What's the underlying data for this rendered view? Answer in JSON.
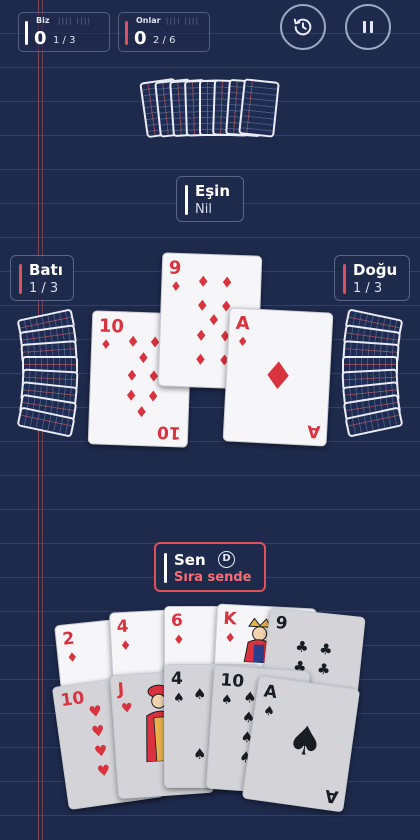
{
  "scores": {
    "us": {
      "label": "Biz",
      "points": "0",
      "tricks": "1 / 3",
      "color": "#ffffff"
    },
    "them": {
      "label": "Onlar",
      "points": "0",
      "tricks": "2 / 6",
      "color": "#e0505a"
    }
  },
  "controls": {
    "history_icon": "history-icon",
    "pause_icon": "pause-icon"
  },
  "players": {
    "partner": {
      "name": "Eşin",
      "bid": "Nil",
      "color": "#ffffff"
    },
    "west": {
      "name": "Batı",
      "tricks": "1 / 3",
      "color": "#e0505a"
    },
    "east": {
      "name": "Doğu",
      "tricks": "1 / 3",
      "color": "#e0505a"
    },
    "me": {
      "name": "Sen",
      "dealer_badge": "D",
      "status": "Sıra sende",
      "color": "#ffffff",
      "status_color": "#ff6b73"
    }
  },
  "table_cards": [
    {
      "rank": "10",
      "suit": "♦",
      "color": "red"
    },
    {
      "rank": "9",
      "suit": "♦",
      "color": "red"
    },
    {
      "rank": "A",
      "suit": "♦",
      "color": "red"
    }
  ],
  "hand_top_row": [
    {
      "rank": "2",
      "suit": "♦",
      "color": "red"
    },
    {
      "rank": "4",
      "suit": "♦",
      "color": "red"
    },
    {
      "rank": "6",
      "suit": "♦",
      "color": "red"
    },
    {
      "rank": "K",
      "suit": "♦",
      "color": "red"
    },
    {
      "rank": "9",
      "suit": "♣",
      "color": "black"
    }
  ],
  "hand_bottom_row": [
    {
      "rank": "10",
      "suit": "♥",
      "color": "red"
    },
    {
      "rank": "J",
      "suit": "♥",
      "color": "red"
    },
    {
      "rank": "4",
      "suit": "♠",
      "color": "black"
    },
    {
      "rank": "10",
      "suit": "♠",
      "color": "black"
    },
    {
      "rank": "A",
      "suit": "♠",
      "color": "black"
    }
  ]
}
